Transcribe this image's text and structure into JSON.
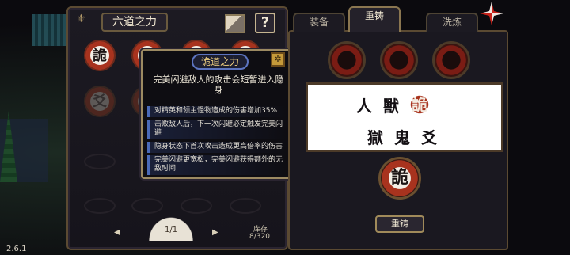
{
  "version": "2.6.1",
  "left_panel": {
    "title": "六道之力",
    "help_label": "?",
    "runes": [
      {
        "char": "詭",
        "state": "active"
      },
      {
        "char": "詭",
        "state": "active"
      },
      {
        "char": "詭",
        "state": "active"
      },
      {
        "char": "詭",
        "state": "active"
      },
      {
        "char": "爻",
        "state": "dim"
      },
      {
        "char": "爻",
        "state": "dim"
      }
    ],
    "pager": {
      "page": "1/1",
      "prev": "◀",
      "next": "▶"
    },
    "storage": {
      "label": "库存",
      "value": "8/320"
    }
  },
  "tooltip": {
    "title": "诡道之力",
    "description": "完美闪避敌人的攻击会短暂进入隐身",
    "effects": [
      "对精英和领主怪物造成的伤害增加35%",
      "击败敌人后，下一次闪避必定触发完美闪避",
      "隐身状态下首次攻击造成更高倍率的伤害",
      "完美闪避更宽松，完美闪避获得额外的无敌时间"
    ]
  },
  "right_panel": {
    "tabs": [
      {
        "label": "装备",
        "active": false
      },
      {
        "label": "重铸",
        "active": true
      },
      {
        "label": "洗炼",
        "active": false
      }
    ],
    "recipe_row1": [
      "人",
      "獸",
      "詭"
    ],
    "recipe_row2": [
      "獄",
      "鬼",
      "爻"
    ],
    "result_char": "詭",
    "reforge_label": "重铸"
  }
}
